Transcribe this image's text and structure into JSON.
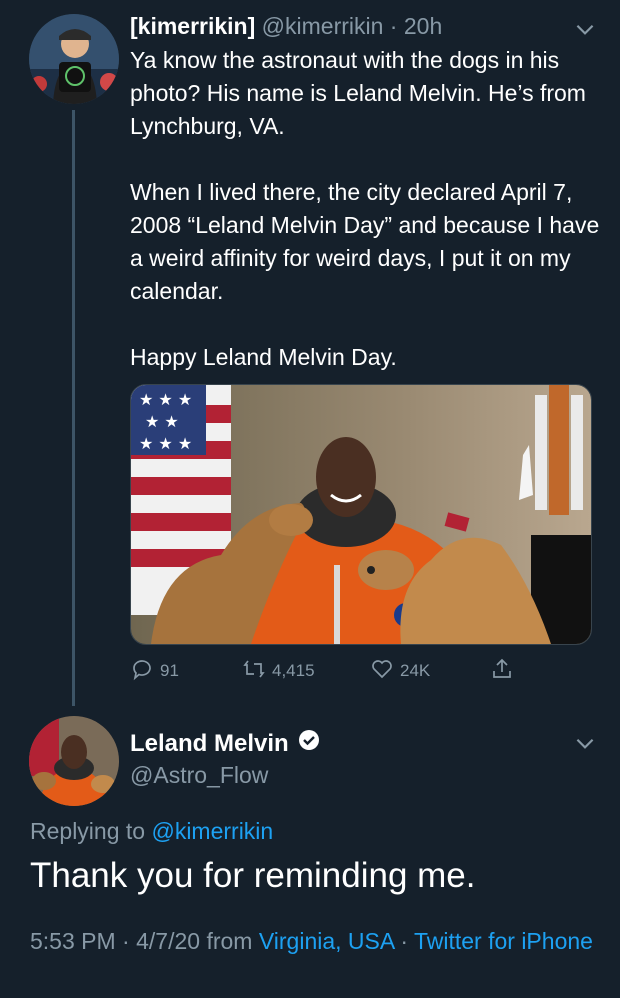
{
  "tweet1": {
    "display_name": "[kimerrikin]",
    "handle": "@kimerrikin",
    "separator": " · ",
    "time": "20h",
    "text": [
      "Ya know the astronaut with the dogs in his photo? His name is Leland Melvin. He’s from Lynchburg, VA.",
      "When I lived there, the city declared April 7, 2008 “Leland Melvin Day” and because I have a weird affinity for weird days, I put it on my calendar.",
      "Happy Leland Melvin Day."
    ],
    "actions": {
      "replies": "91",
      "retweets": "4,415",
      "likes": "24K"
    }
  },
  "tweet2": {
    "display_name": "Leland Melvin",
    "handle": "@Astro_Flow",
    "replying_prefix": "Replying to ",
    "replying_handle": "@kimerrikin",
    "text": "Thank you for reminding me.",
    "time": "5:53 PM",
    "sep1": " · ",
    "date": "4/7/20",
    "from_word": " from ",
    "location": "Virginia, USA",
    "sep2": " · ",
    "source": "Twitter for iPhone"
  },
  "colors": {
    "background": "#15202b",
    "muted": "#8899a6",
    "link": "#1da1f2",
    "verified": "#ffffff"
  },
  "icons": [
    "chevron-down-icon",
    "reply-icon",
    "retweet-icon",
    "like-icon",
    "share-icon",
    "verified-icon"
  ]
}
